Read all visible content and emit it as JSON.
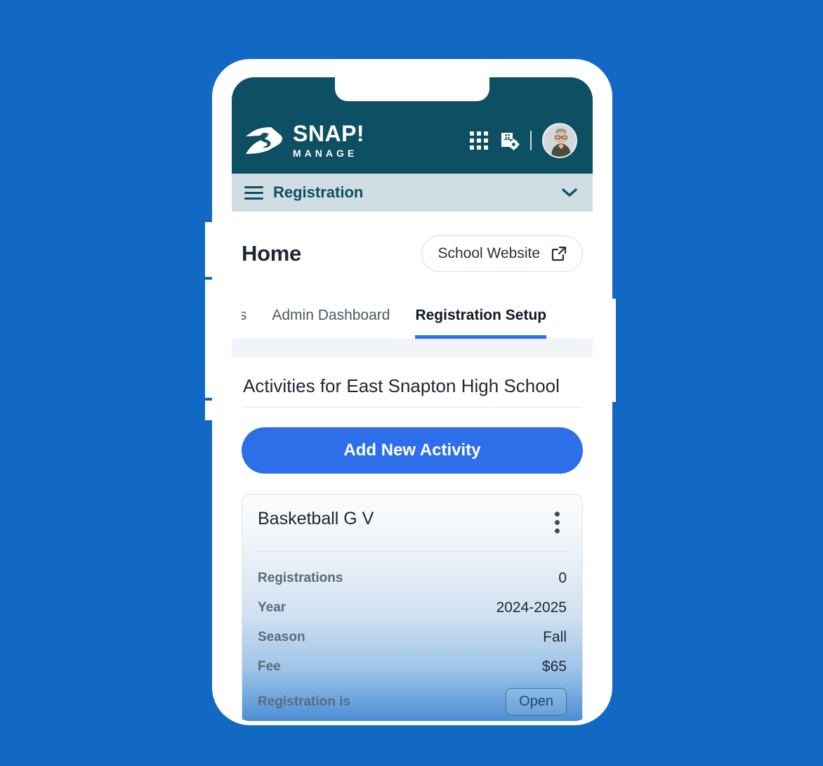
{
  "brand": {
    "logo_primary": "SNAP!",
    "logo_secondary": "MANAGE",
    "logo_mark_icon": "snap-s-logo-icon",
    "header_color": "#0d4f63",
    "accent_color": "#2d6fe8",
    "background_color": "#1269c4"
  },
  "header": {
    "apps_icon": "grid-apps-icon",
    "settings_icon": "school-settings-gear-icon",
    "avatar_icon": "user-avatar"
  },
  "sub_bar": {
    "menu_icon": "hamburger-menu-icon",
    "title": "Registration",
    "chevron_icon": "chevron-down-icon"
  },
  "page": {
    "title": "Home",
    "website_button": {
      "label": "School Website",
      "icon": "external-link-icon"
    }
  },
  "tabs": [
    {
      "label": "amps",
      "active": false
    },
    {
      "label": "Admin Dashboard",
      "active": false
    },
    {
      "label": "Registration Setup",
      "active": true
    }
  ],
  "activities": {
    "heading": "Activities for East Snapton High School",
    "add_button_label": "Add New Activity",
    "cards": [
      {
        "title": "Basketball G V",
        "menu_icon": "kebab-menu-icon",
        "details": [
          {
            "label": "Registrations",
            "value": "0"
          },
          {
            "label": "Year",
            "value": "2024-2025"
          },
          {
            "label": "Season",
            "value": "Fall"
          },
          {
            "label": "Fee",
            "value": "$65"
          }
        ],
        "status": {
          "label": "Registration is",
          "value": "Open"
        }
      }
    ]
  }
}
